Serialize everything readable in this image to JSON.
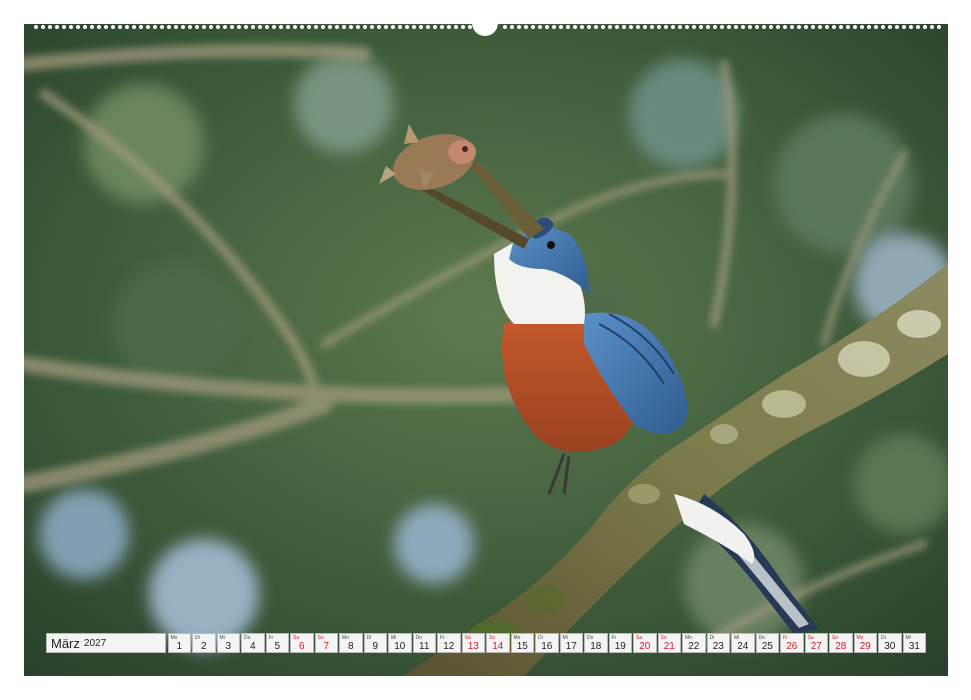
{
  "calendar": {
    "month": "März",
    "year": "2027",
    "days": [
      {
        "wd": "Mo",
        "n": "1",
        "red": false
      },
      {
        "wd": "Di",
        "n": "2",
        "red": false
      },
      {
        "wd": "Mi",
        "n": "3",
        "red": false
      },
      {
        "wd": "Do",
        "n": "4",
        "red": false
      },
      {
        "wd": "Fr",
        "n": "5",
        "red": false
      },
      {
        "wd": "Sa",
        "n": "6",
        "red": true
      },
      {
        "wd": "So",
        "n": "7",
        "red": true
      },
      {
        "wd": "Mo",
        "n": "8",
        "red": false
      },
      {
        "wd": "Di",
        "n": "9",
        "red": false
      },
      {
        "wd": "Mi",
        "n": "10",
        "red": false
      },
      {
        "wd": "Do",
        "n": "11",
        "red": false
      },
      {
        "wd": "Fr",
        "n": "12",
        "red": false
      },
      {
        "wd": "Sa",
        "n": "13",
        "red": true
      },
      {
        "wd": "So",
        "n": "14",
        "red": true
      },
      {
        "wd": "Mo",
        "n": "15",
        "red": false
      },
      {
        "wd": "Di",
        "n": "16",
        "red": false
      },
      {
        "wd": "Mi",
        "n": "17",
        "red": false
      },
      {
        "wd": "Do",
        "n": "18",
        "red": false
      },
      {
        "wd": "Fr",
        "n": "19",
        "red": false
      },
      {
        "wd": "Sa",
        "n": "20",
        "red": true
      },
      {
        "wd": "So",
        "n": "21",
        "red": true
      },
      {
        "wd": "Mo",
        "n": "22",
        "red": false
      },
      {
        "wd": "Di",
        "n": "23",
        "red": false
      },
      {
        "wd": "Mi",
        "n": "24",
        "red": false
      },
      {
        "wd": "Do",
        "n": "25",
        "red": false
      },
      {
        "wd": "Fr",
        "n": "26",
        "red": true
      },
      {
        "wd": "Sa",
        "n": "27",
        "red": true
      },
      {
        "wd": "So",
        "n": "28",
        "red": true
      },
      {
        "wd": "Mo",
        "n": "29",
        "red": true
      },
      {
        "wd": "Di",
        "n": "30",
        "red": false
      },
      {
        "wd": "Mi",
        "n": "31",
        "red": false
      }
    ]
  },
  "colors": {
    "weekend": "#d2202c",
    "bird_blue": "#4a7eb5",
    "bird_rufous": "#b8532b",
    "foliage": "#3b5736"
  }
}
